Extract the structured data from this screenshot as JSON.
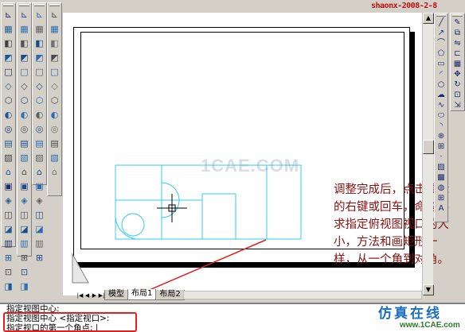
{
  "stamp": "shaonx-2008-2-8",
  "watermark": "1CAE.COM",
  "instruction": "调整完成后，点击鼠标的右键或回车，命令要求指定俯视图视口的大小，方法和画矩形一样，从一个角到对角。",
  "tabs": [
    {
      "label": "模型",
      "active": false
    },
    {
      "label": "布局1",
      "active": true
    },
    {
      "label": "布局2",
      "active": false
    }
  ],
  "command_lines": [
    "指定视图中心:",
    "指定视图中心 <指定视口>:",
    "指定视口的第一个角点: |"
  ],
  "logo": {
    "text": "仿真在线",
    "url": "www.1CAE.com"
  },
  "colors": {
    "drawing": "#33ccee",
    "instruction": "#8a1010",
    "highlight": "#e02020",
    "stamp": "#c01010"
  },
  "left_toolbar_icons": [
    [
      "line-icon",
      "viewport-icon",
      "pan-icon",
      "zoom-icon",
      "grid-icon",
      "snap-icon",
      "ortho-icon",
      "polar-icon",
      "osnap-icon",
      "otrack-icon",
      "lwt-icon",
      "model-icon",
      "layer-icon",
      "color-icon",
      "linetype-icon",
      "lineweight-icon",
      "plot-icon",
      "preview-icon",
      "find-icon",
      "cut-icon"
    ],
    [
      "ucs-icon",
      "ucs-world-icon",
      "ucs-prev-icon",
      "ucs-face-icon",
      "ucs-object-icon",
      "ucs-view-icon",
      "ucs-origin-icon",
      "ucs-zaxis-icon",
      "ucs-3point-icon",
      "ucs-x-icon",
      "ucs-y-icon",
      "ucs-z-icon",
      "ucs-apply-icon",
      "named-ucs-icon",
      "view-top-icon",
      "view-bottom-icon",
      "view-left-icon",
      "view-right-icon",
      "view-front-icon",
      "view-back-icon"
    ],
    [
      "box-icon",
      "sphere-icon",
      "cylinder-icon",
      "cone-icon",
      "wedge-icon",
      "torus-icon",
      "extrude-icon",
      "revolve-icon",
      "slice-icon",
      "section-icon",
      "interfere-icon",
      "setup-drawing-icon",
      "setup-view-icon",
      "setup-profile-icon",
      "union-icon",
      "subtract-icon",
      "intersect-icon",
      "3dorbit-icon"
    ],
    [
      "shade-2d-icon",
      "shade-3d-icon",
      "hidden-icon",
      "flat-icon",
      "gouraud-icon",
      "flat-edges-icon",
      "gouraud-edges-icon",
      "render-icon",
      "scene-icon",
      "light-icon",
      "material-icon",
      "landscape-icon"
    ]
  ],
  "right_toolbar_icons": [
    "draw-line-icon",
    "construction-line-icon",
    "polyline-icon",
    "polygon-icon",
    "rectangle-icon",
    "arc-icon",
    "circle-icon",
    "revcloud-icon",
    "spline-icon",
    "ellipse-icon",
    "ellipse-arc-icon",
    "insert-block-icon",
    "make-block-icon",
    "point-icon",
    "hatch-icon",
    "gradient-icon",
    "region-icon",
    "table-icon",
    "mtext-icon"
  ],
  "right_toolbar2_icons": [
    "erase-icon",
    "copy-icon",
    "mirror-icon",
    "offset-icon",
    "array-icon",
    "move-icon",
    "rotate-icon",
    "scale-icon",
    "stretch-icon"
  ]
}
